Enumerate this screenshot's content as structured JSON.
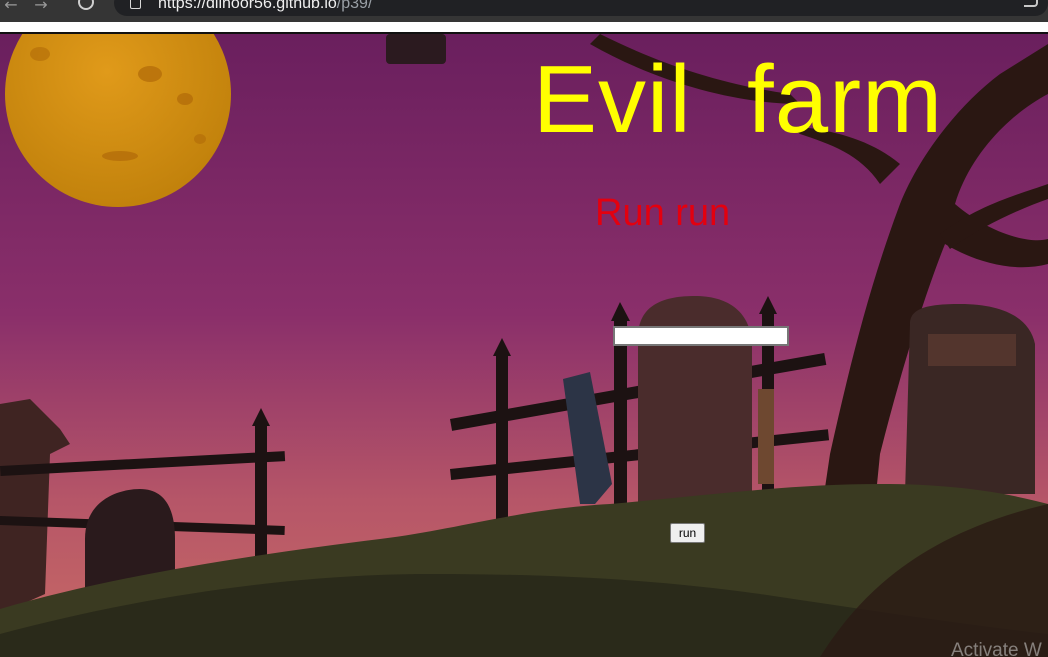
{
  "browser": {
    "url_host": "https://dilnoor56.github.io",
    "url_path": "/p39/",
    "back_glyph": "←",
    "forward_glyph": "→"
  },
  "page": {
    "title": "Evil  farm",
    "subtitle": "Run run",
    "input_value": "",
    "button_label": "run",
    "title_color": "#ffff00",
    "subtitle_color": "#e3000f"
  },
  "overlay": {
    "watermark": "Activate W"
  },
  "colors": {
    "sky_top": "#6a1f5e",
    "sky_bottom": "#c86a64",
    "moon": "#d4900f",
    "hill": "#3a3a21"
  }
}
